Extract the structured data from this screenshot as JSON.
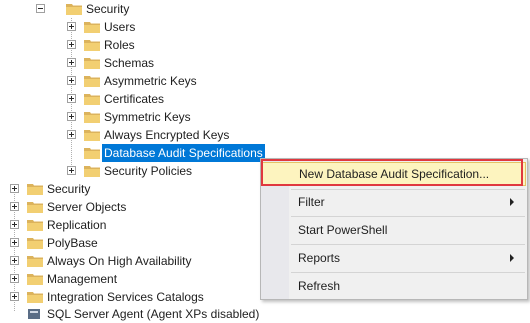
{
  "tree": {
    "security_sub": {
      "label": "Security",
      "children": [
        "Users",
        "Roles",
        "Schemas",
        "Asymmetric Keys",
        "Certificates",
        "Symmetric Keys",
        "Always Encrypted Keys",
        "Database Audit Specifications",
        "Security Policies"
      ]
    },
    "top_level": [
      "Security",
      "Server Objects",
      "Replication",
      "PolyBase",
      "Always On High Availability",
      "Management",
      "Integration Services Catalogs",
      "SQL Server Agent (Agent XPs disabled)"
    ]
  },
  "context_menu": {
    "items": [
      {
        "label": "New Database Audit Specification...",
        "has_submenu": false,
        "highlighted": true
      },
      {
        "label": "Filter",
        "has_submenu": true
      },
      {
        "label": "Start PowerShell",
        "has_submenu": false
      },
      {
        "label": "Reports",
        "has_submenu": true
      },
      {
        "label": "Refresh",
        "has_submenu": false
      }
    ]
  },
  "colors": {
    "selection": "#0078d7",
    "menu_highlight": "#fdf4bf",
    "callout_border": "#e0383f",
    "folder": "#dcb35c"
  }
}
